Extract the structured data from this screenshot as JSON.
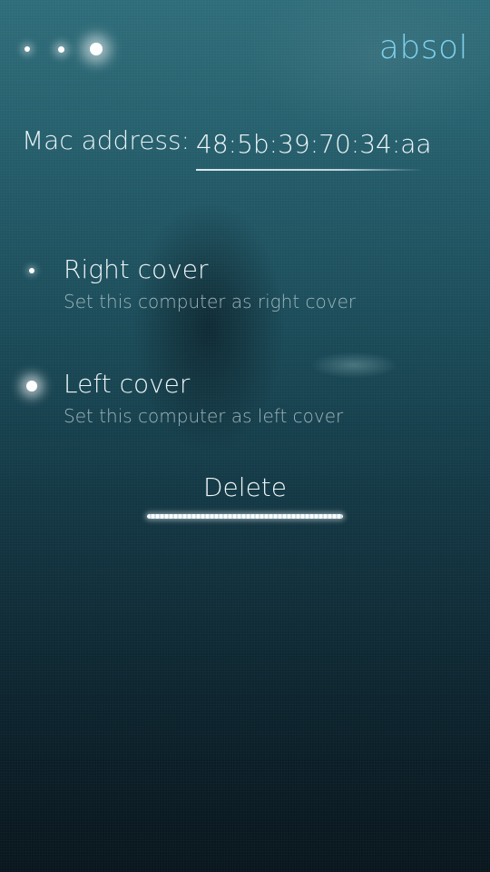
{
  "header": {
    "title": "absol",
    "pulley_menu_icon": "pulley-menu-indicator-icon"
  },
  "form": {
    "mac_label": "Mac address:",
    "mac_value": "48:5b:39:70:34:aa"
  },
  "options": {
    "right": {
      "label": "Right cover",
      "description": "Set this computer as right cover",
      "selected": false
    },
    "left": {
      "label": "Left cover",
      "description": "Set this computer as left cover",
      "selected": true
    }
  },
  "actions": {
    "delete_label": "Delete"
  },
  "colors": {
    "accent": "#7fd0ec",
    "primary_text": "#eef6f7",
    "secondary_text": "#9fb6bd",
    "background_top": "#2f6d7a",
    "background_bottom": "#09161d"
  }
}
